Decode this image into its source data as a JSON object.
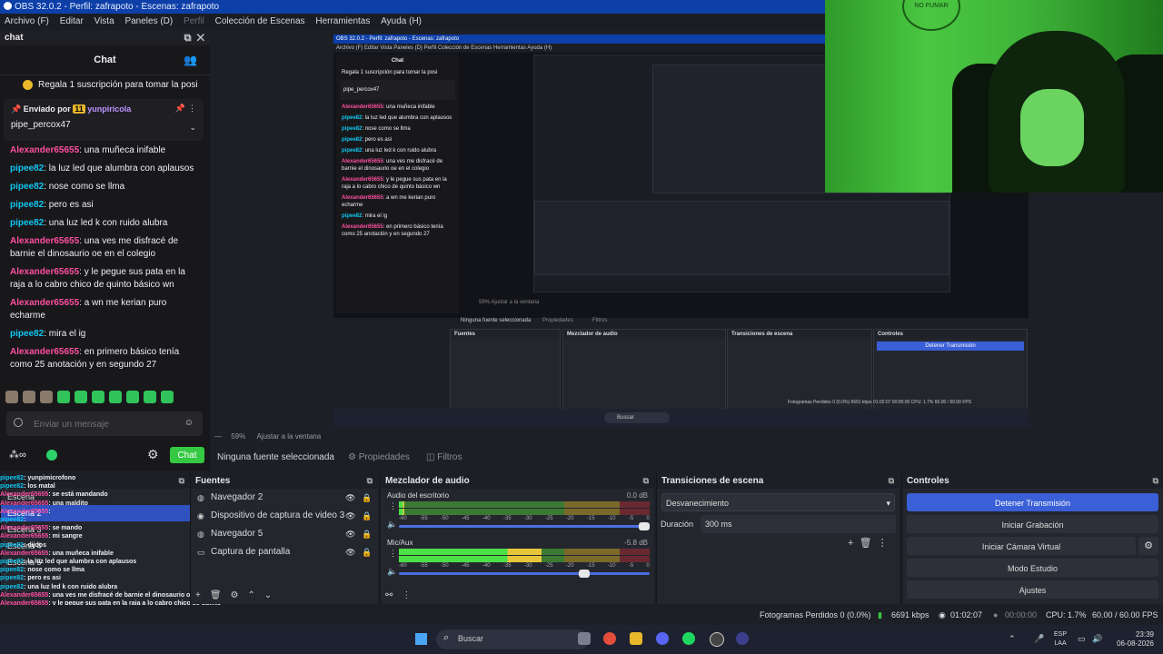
{
  "window": {
    "title": "OBS 32.0.2 - Perfil: zafrapoto - Escenas: zafrapoto"
  },
  "menu": [
    "Archivo (F)",
    "Editar",
    "Vista",
    "Paneles (D)",
    "Perfil",
    "Colección de Escenas",
    "Herramientas",
    "Ayuda (H)"
  ],
  "chat": {
    "dock_title": "chat",
    "header": "Chat",
    "promo": "Regala 1 suscripción para tomar la posi",
    "pinned_by_label": "Enviado por",
    "pinned_badge": "11",
    "pinned_user": "yunpiricola",
    "pinned_text": "pipe_percox47",
    "messages": [
      {
        "user": "Alexander65655",
        "ucolor": "u2",
        "text": ": una muñeca inifable"
      },
      {
        "user": "pipee82",
        "ucolor": "u1",
        "text": ": la luz led que alumbra con aplausos"
      },
      {
        "user": "pipee82",
        "ucolor": "u1",
        "text": ": nose como se llma"
      },
      {
        "user": "pipee82",
        "ucolor": "u1",
        "text": ": pero es asi"
      },
      {
        "user": "pipee82",
        "ucolor": "u1",
        "text": ": una luz led k con ruido alubra"
      },
      {
        "user": "Alexander65655",
        "ucolor": "u2",
        "text": ": una ves me disfracé de barnie el dinosaurio oe en el colegio"
      },
      {
        "user": "Alexander65655",
        "ucolor": "u2",
        "text": ": y le pegue sus pata en la raja a lo cabro chico de quinto básico wn"
      },
      {
        "user": "Alexander65655",
        "ucolor": "u2",
        "text": ": a wn me kerian puro echarme"
      },
      {
        "user": "pipee82",
        "ucolor": "u1",
        "text": ": mira el ig"
      },
      {
        "user": "Alexander65655",
        "ucolor": "u2",
        "text": ": en primero básico tenía como 25 anotación y en segundo 27"
      }
    ],
    "input_placeholder": "Enviar un mensaje",
    "send_label": "Chat"
  },
  "nested_preview": {
    "title": "OBS 32.0.2 - Perfil: zafrapoto - Escenas: zafrapoto",
    "menu": "Archivo (F)   Editar   Vista   Paneles (D)   Perfil   Colección de Escenas   Herramientas   Ayuda (H)",
    "chat_header": "Chat",
    "promo": "Regala 1 suscripción para tomar la posi",
    "pinned_text": "pipe_percox47",
    "no_source": "Ninguna fuente seleccionada",
    "properties": "Propiedades",
    "filters": "Filtros",
    "panels": [
      "Fuentes",
      "Mezclador de audio",
      "Transiciones de escena",
      "Controles"
    ],
    "stop": "Detener Transmisión",
    "status": "Fotogramas Perdidos 0 (0.0%)   6691 kbps   01:02:07   00:00:00   CPU: 1.7%   60.00 / 60.00 FPS",
    "search": "Buscar",
    "zoom": "59%   Ajustar a la ventana"
  },
  "preview_toolbar": {
    "zoom": "59%",
    "fit": "Ajustar a la ventana"
  },
  "source_toolbar": {
    "no_source": "Ninguna fuente seleccionada",
    "properties": "Propiedades",
    "filters": "Filtros"
  },
  "scenes": {
    "items": [
      "Escena",
      "Escena 2",
      "Escena 3",
      "Escena 4",
      "Escena 5"
    ],
    "active_index": 1
  },
  "scene_overlay_chat": [
    {
      "user": "pipee82",
      "ucolor": "u1",
      "text": ": yunpimicrofono"
    },
    {
      "user": "pipee82",
      "ucolor": "u1",
      "text": ": los matal"
    },
    {
      "user": "Alexander65655",
      "ucolor": "u2",
      "text": ": se está mandando"
    },
    {
      "user": "Alexander65655",
      "ucolor": "u2",
      "text": ": una maldito"
    },
    {
      "user": "Alexander65655",
      "ucolor": "u2",
      "text": ":"
    },
    {
      "user": "pipee82",
      "ucolor": "u1",
      "text": ":"
    },
    {
      "user": "Alexander65655",
      "ucolor": "u2",
      "text": ": se mando"
    },
    {
      "user": "Alexander65655",
      "ucolor": "u2",
      "text": ": mi sangre"
    },
    {
      "user": "pipee82",
      "ucolor": "u1",
      "text": ": dijdos"
    },
    {
      "user": "Alexander65655",
      "ucolor": "u2",
      "text": ": una muñeca inifable"
    },
    {
      "user": "pipee82",
      "ucolor": "u1",
      "text": ": la luz led que alumbra con aplausos"
    },
    {
      "user": "pipee82",
      "ucolor": "u1",
      "text": ": nose como se llma"
    },
    {
      "user": "pipee82",
      "ucolor": "u1",
      "text": ": pero es asi"
    },
    {
      "user": "pipee82",
      "ucolor": "u1",
      "text": ": una luz led k con ruido alubra"
    },
    {
      "user": "Alexander65655",
      "ucolor": "u2",
      "text": ": una ves me disfracé de barnie el dinosaurio oe en el colegio"
    },
    {
      "user": "Alexander65655",
      "ucolor": "u2",
      "text": ": y le pegue sus pata en la raja a lo cabro chico de quinto"
    },
    {
      "user": "",
      "ucolor": "u2",
      "text": "básico wn"
    },
    {
      "user": "Alexander65655",
      "ucolor": "u2",
      "text": ": a wn me kerian puro echarme"
    },
    {
      "user": "pipee82",
      "ucolor": "u1",
      "text": ": mira el ig"
    },
    {
      "user": "Alexander65655",
      "ucolor": "u2",
      "text": ": en primero básico tenía como 25 anotación y en segundo 27"
    }
  ],
  "sources": {
    "title": "Fuentes",
    "items": [
      {
        "label": "Navegador 2",
        "icon": "globe-icon"
      },
      {
        "label": "Dispositivo de captura de video 3",
        "icon": "camera-icon"
      },
      {
        "label": "Navegador 5",
        "icon": "globe-icon"
      },
      {
        "label": "Captura de pantalla",
        "icon": "monitor-icon"
      }
    ]
  },
  "mixer": {
    "title": "Mezclador de audio",
    "channels": [
      {
        "name": "Audio del escritorio",
        "db": "0.0 dB",
        "level": 0.02,
        "volume": 0.98
      },
      {
        "name": "Mic/Aux",
        "db": "-5.8 dB",
        "level": 0.57,
        "volume": 0.74
      }
    ],
    "scale": [
      "-60",
      "-55",
      "-50",
      "-45",
      "-40",
      "-35",
      "-30",
      "-25",
      "-20",
      "-15",
      "-10",
      "-5",
      "0"
    ]
  },
  "transitions": {
    "title": "Transiciones de escena",
    "selected": "Desvanecimiento",
    "duration_label": "Duración",
    "duration_value": "300 ms"
  },
  "controls": {
    "title": "Controles",
    "stop_stream": "Detener Transmisión",
    "start_record": "Iniciar Grabación",
    "start_vcam": "Iniciar Cámara Virtual",
    "studio_mode": "Modo Estudio",
    "settings": "Ajustes"
  },
  "status": {
    "dropped": "Fotogramas Perdidos 0 (0.0%)",
    "bitrate": "6691 kbps",
    "stream_time": "01:02:07",
    "rec_time": "00:00:00",
    "cpu": "CPU: 1.7%",
    "fps": "60.00 / 60.00 FPS"
  },
  "taskbar": {
    "search": "Buscar",
    "lang1": "ESP",
    "lang2": "LAA",
    "time": "23:39",
    "date": "06-08-2026"
  },
  "colors": {
    "accent": "#3a5fd6",
    "chat_green": "#35c842",
    "title_blue": "#0d3fa8"
  }
}
